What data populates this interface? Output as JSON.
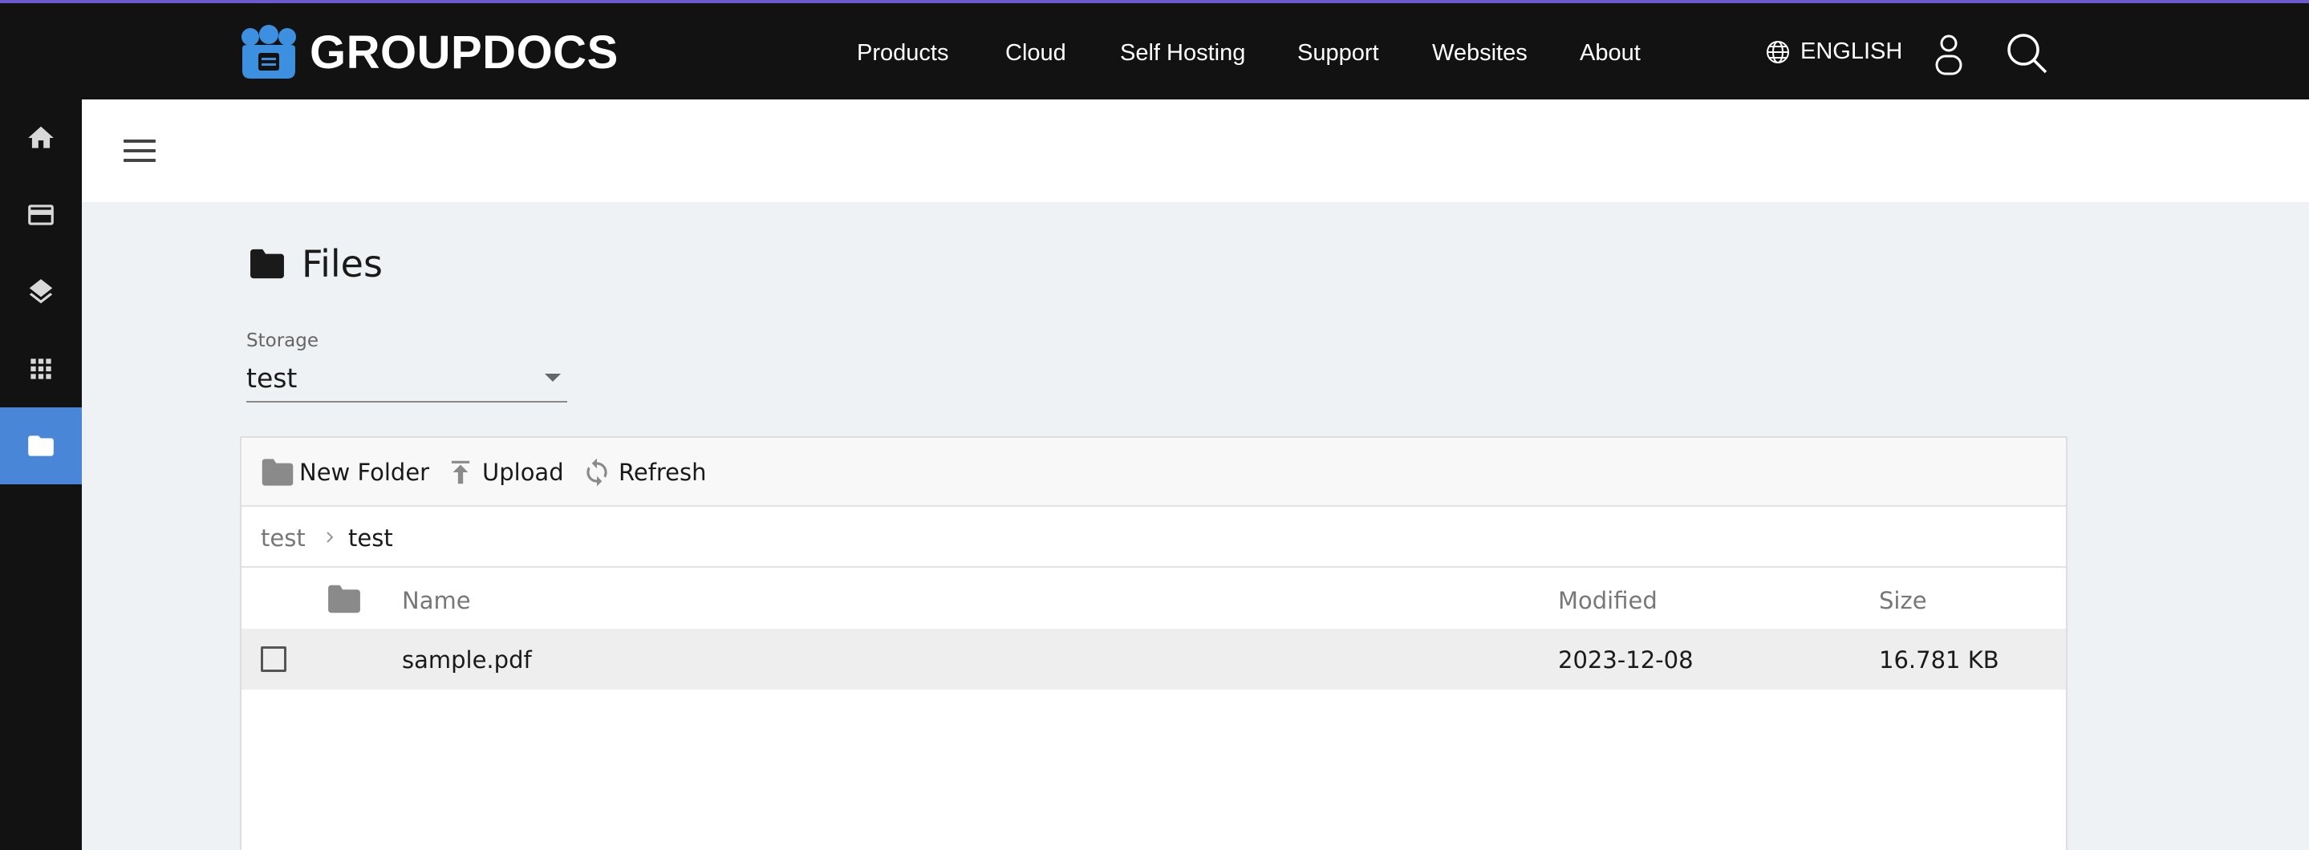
{
  "brand": {
    "name": "GROUPDOCS",
    "accent": "#4a86d8",
    "nav_bg": "#121212"
  },
  "nav": {
    "items": [
      {
        "label": "Products"
      },
      {
        "label": "Cloud"
      },
      {
        "label": "Self Hosting"
      },
      {
        "label": "Support"
      },
      {
        "label": "Websites"
      },
      {
        "label": "About"
      }
    ],
    "language": "ENGLISH"
  },
  "sidebar": {
    "items": [
      {
        "icon": "home-icon"
      },
      {
        "icon": "credit-card-icon"
      },
      {
        "icon": "layers-icon"
      },
      {
        "icon": "apps-grid-icon"
      },
      {
        "icon": "folder-icon",
        "active": true
      }
    ]
  },
  "page": {
    "title": "Files"
  },
  "storage": {
    "label": "Storage",
    "value": "test"
  },
  "toolbar": {
    "new_folder": "New Folder",
    "upload": "Upload",
    "refresh": "Refresh"
  },
  "breadcrumb": {
    "root": "test",
    "current": "test"
  },
  "table": {
    "headers": {
      "name": "Name",
      "modified": "Modified",
      "size": "Size"
    },
    "rows": [
      {
        "name": "sample.pdf",
        "modified": "2023-12-08",
        "size": "16.781 KB"
      }
    ]
  }
}
